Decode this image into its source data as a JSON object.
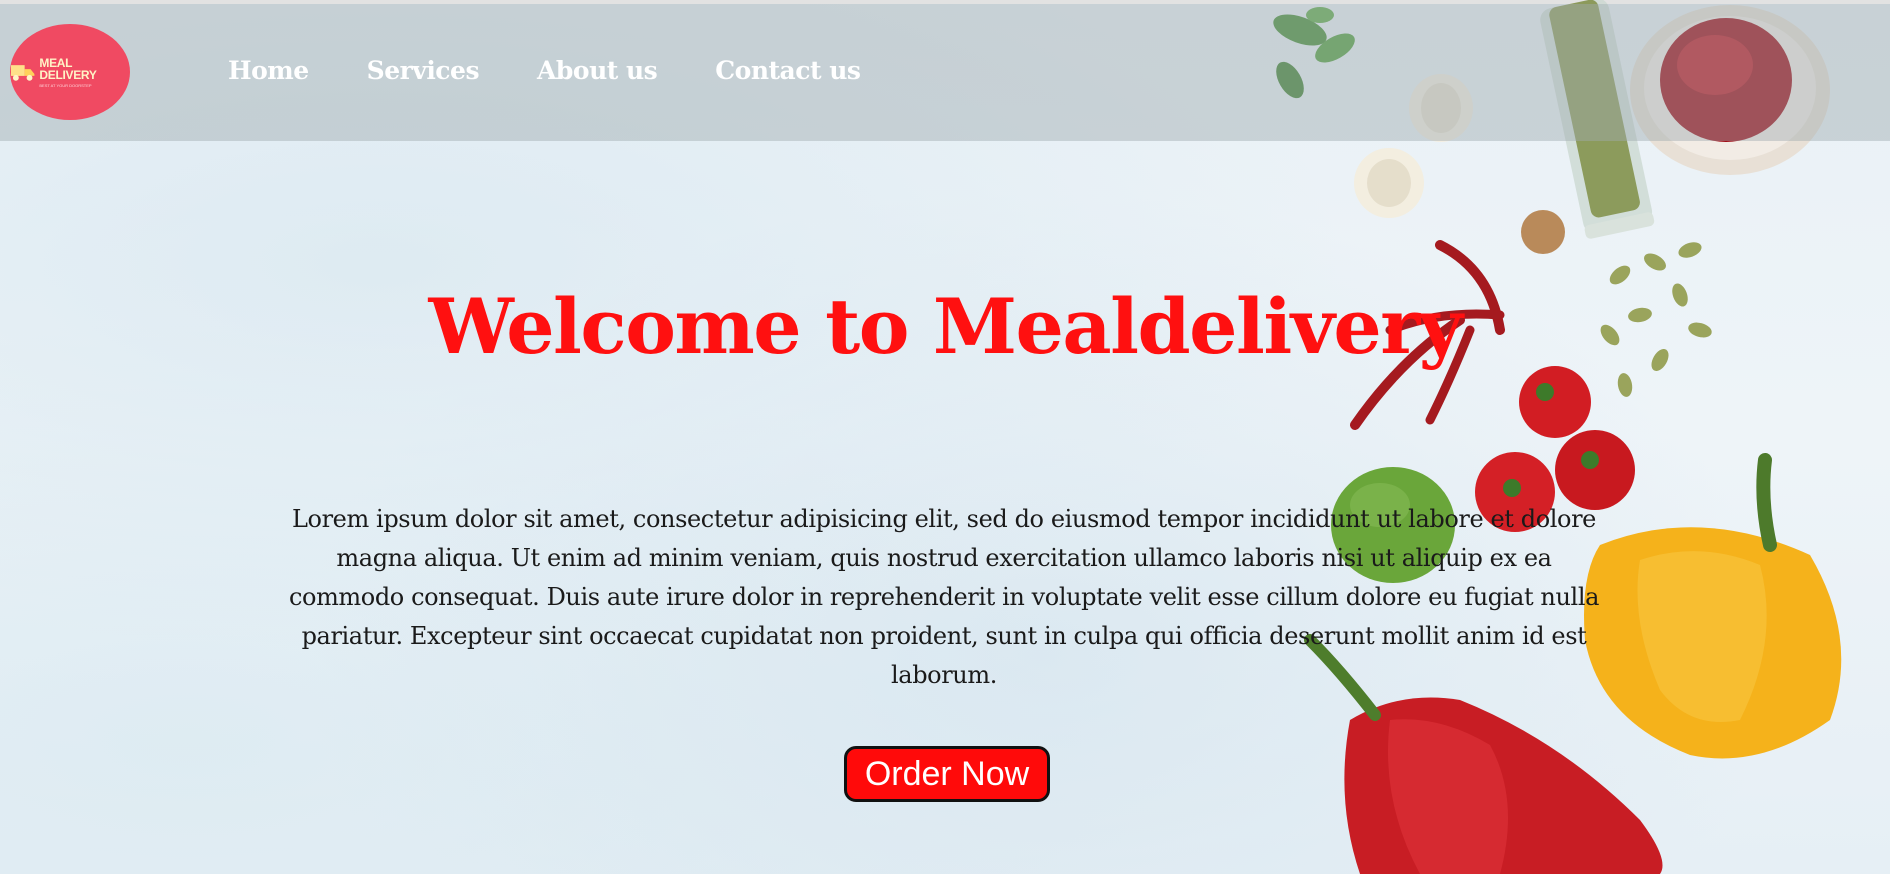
{
  "logo": {
    "title": "MEAL DELIVERY",
    "tagline": "BEST AT YOUR DOORSTEP"
  },
  "nav": {
    "items": [
      {
        "label": "Home"
      },
      {
        "label": "Services"
      },
      {
        "label": "About us"
      },
      {
        "label": "Contact us"
      }
    ]
  },
  "hero": {
    "title": "Welcome to Mealdelivery",
    "text": "Lorem ipsum dolor sit amet, consectetur adipisicing elit, sed do eiusmod tempor incididunt ut labore et dolore magna aliqua. Ut enim ad minim veniam, quis nostrud exercitation ullamco laboris nisi ut aliquip ex ea commodo consequat. Duis aute irure dolor in reprehenderit in voluptate velit esse cillum dolore eu fugiat nulla pariatur. Excepteur sint occaecat cupidatat non proident, sunt in culpa qui officia deserunt mollit anim id est laborum.",
    "button_label": "Order Now"
  },
  "colors": {
    "accent": "#ff1010",
    "logo_bg": "#f04a62",
    "button_bg": "#ff0a0a"
  },
  "icons": [
    "truck-icon"
  ]
}
